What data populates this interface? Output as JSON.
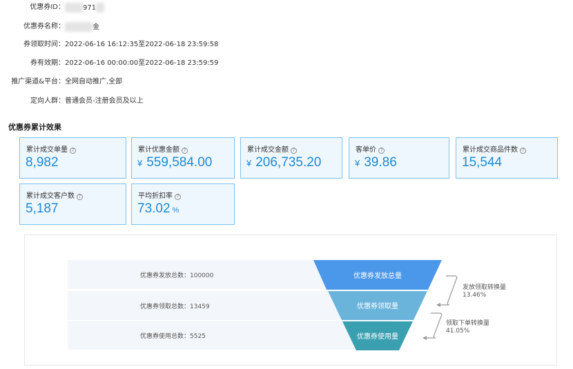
{
  "coupon_info": {
    "id_label": "优惠券ID：",
    "id_value": "971",
    "name_label": "优惠券名称：",
    "name_value": "金",
    "claim_time_label": "券领取时间：",
    "claim_time_value": "2022-06-16 16:12:35至2022-06-18 23:59:58",
    "valid_label": "券有效期：",
    "valid_value": "2022-06-16 00:00:00至2022-06-18 23:59:59",
    "channel_label": "推广渠道&平台：",
    "channel_value": "全网自动推广,全部",
    "audience_label": "定向人群：",
    "audience_value": "普通会员-注册会员及以上"
  },
  "section_title": "优惠券累计效果",
  "cards": [
    {
      "label": "累计成交单量",
      "currency": "",
      "value": "8,982",
      "unit": ""
    },
    {
      "label": "累计优惠金额",
      "currency": "¥",
      "value": "559,584.00",
      "unit": ""
    },
    {
      "label": "累计成交金额",
      "currency": "¥",
      "value": "206,735.20",
      "unit": ""
    },
    {
      "label": "客单价",
      "currency": "¥",
      "value": "39.86",
      "unit": ""
    },
    {
      "label": "累计成交商品件数",
      "currency": "",
      "value": "15,544",
      "unit": ""
    },
    {
      "label": "累计成交客户数",
      "currency": "",
      "value": "5,187",
      "unit": ""
    },
    {
      "label": "平均折扣率",
      "currency": "",
      "value": "73.02",
      "unit": "%"
    }
  ],
  "help_icon_glyph": "?",
  "funnel": {
    "rows": [
      {
        "label": "优惠券发放总数：100000",
        "stage": "优惠券发放总量",
        "color": "#4b97ea"
      },
      {
        "label": "优惠券领取总数：13459",
        "stage": "优惠券领取量",
        "color": "#6ab4dc"
      },
      {
        "label": "优惠券使用总数：5525",
        "stage": "优惠券使用量",
        "color": "#3aa0b0"
      }
    ],
    "conversions": [
      {
        "name": "发放领取转换量",
        "value": "13.46%"
      },
      {
        "name": "领取下单转换量",
        "value": "41.05%"
      }
    ]
  }
}
